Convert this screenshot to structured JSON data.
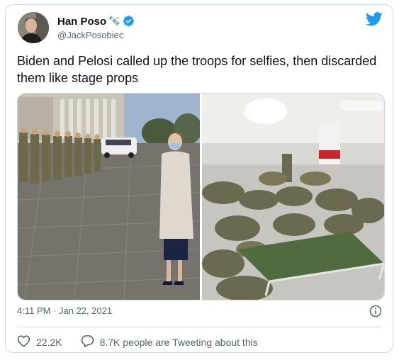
{
  "author": {
    "name": "Han Poso",
    "handle": "@JackPosobiec"
  },
  "tweet": {
    "text": "Biden and Pelosi called up the troops for selfies, then discarded them like stage props",
    "timestamp": "4:11 PM · Jan 22, 2021"
  },
  "stats": {
    "likes": "22.2K",
    "conversation": "8.7K people are Tweeting about this"
  },
  "colors": {
    "brand": "#1d9bf0",
    "verified": "#1d9bf0",
    "secondary_text": "#536471",
    "border": "#cfd9de"
  },
  "icons": {
    "bird": "twitter-bird-icon",
    "verified": "verified-badge-icon",
    "satellite": "satellite-emoji-icon",
    "like": "heart-icon",
    "reply": "speech-bubble-icon",
    "info": "info-icon"
  }
}
